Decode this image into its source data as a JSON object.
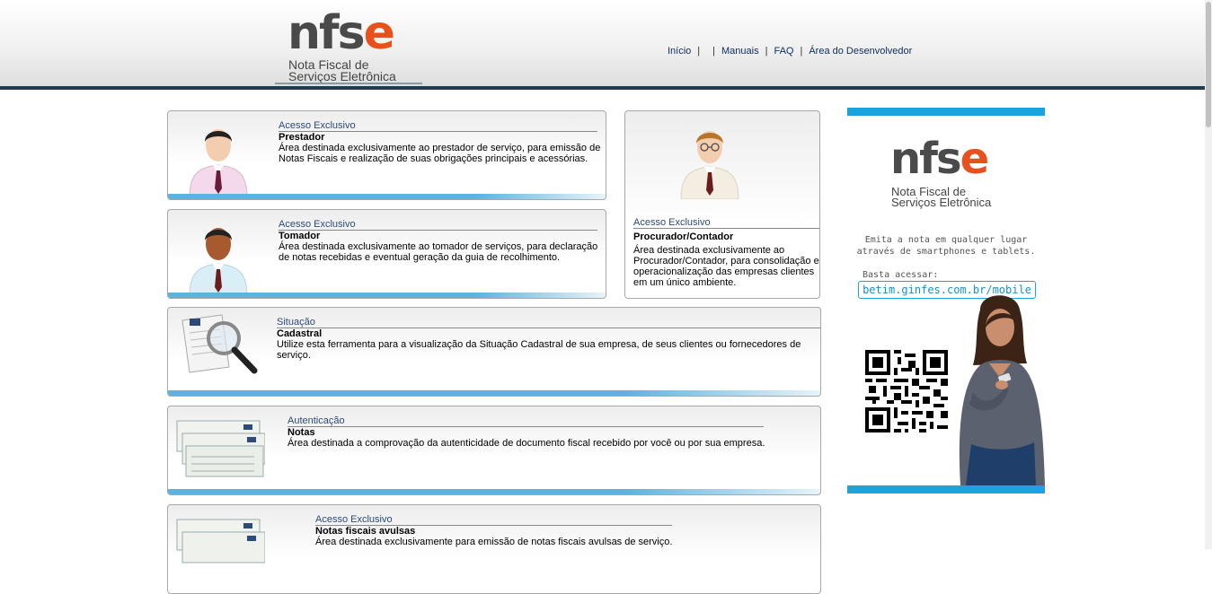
{
  "header": {
    "logo_word_main": "nfs",
    "logo_word_accent": "e",
    "logo_line1": "Nota Fiscal de",
    "logo_line2": "Serviços Eletrônica"
  },
  "nav": {
    "items": [
      "Início",
      "Manuais",
      "FAQ",
      "Área do Desenvolvedor"
    ],
    "separators": [
      "|",
      "|",
      "|",
      "|"
    ]
  },
  "cards": {
    "prestador": {
      "title": "Acesso Exclusivo",
      "subtitle": "Prestador",
      "description": "Área destinada exclusivamente ao prestador de serviço, para emissão de Notas Fiscais e realização de suas obrigações principais e acessórias."
    },
    "tomador": {
      "title": "Acesso Exclusivo",
      "subtitle": "Tomador",
      "description": "Área destinada exclusivamente ao tomador de serviços, para declaração de notas recebidas e eventual geração da guia de recolhimento."
    },
    "procurador": {
      "title": "Acesso Exclusivo",
      "subtitle": "Procurador/Contador",
      "description": "Área destinada exclusivamente ao Procurador/Contador, para consolidação e operacionalização das empresas clientes em um único ambiente."
    },
    "situacao": {
      "title": "Situação",
      "subtitle": "Cadastral",
      "description": "Utilize esta ferramenta para a visualização da Situação Cadastral de sua empresa, de seus clientes ou fornecedores de serviço."
    },
    "autenticacao": {
      "title": "Autenticação",
      "subtitle": "Notas",
      "description": "Área destinada a comprovação da autenticidade de documento fiscal recebido por você ou por sua empresa."
    },
    "avulsas": {
      "title": "Acesso Exclusivo",
      "subtitle": "Notas fiscais avulsas",
      "description": "Área destinada exclusivamente para emissão de notas fiscais avulsas de serviço."
    }
  },
  "ad": {
    "logo_word_main": "nfs",
    "logo_word_accent": "e",
    "logo_line1": "Nota Fiscal de",
    "logo_line2": "Serviços Eletrônica",
    "tagline1": "Emita a nota em qualquer lugar",
    "tagline2": "através de smartphones e tablets.",
    "basta": "Basta acessar:",
    "url": "betim.ginfes.com.br/mobile"
  },
  "colors": {
    "header_rule": "#1f3c4c",
    "card_bar": "#5db2de",
    "ad_accent": "#1aa3dd",
    "logo_accent": "#e8501c",
    "nav_link": "#112e63"
  }
}
